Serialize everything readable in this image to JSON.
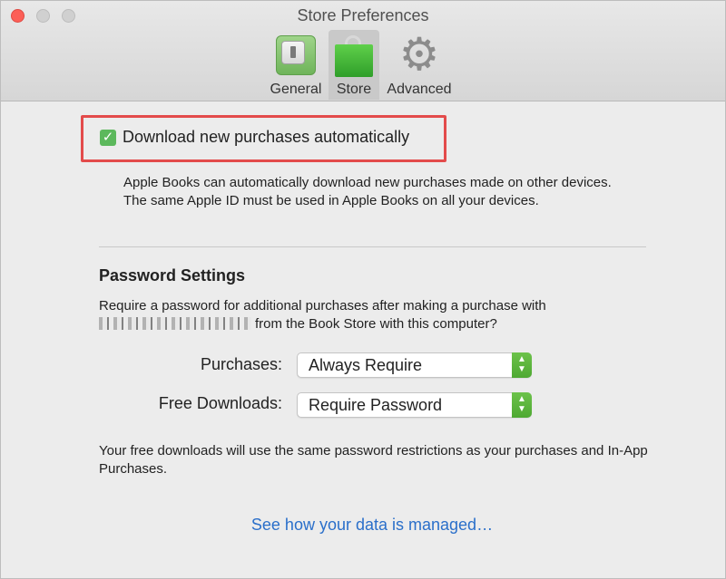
{
  "window": {
    "title": "Store Preferences"
  },
  "toolbar": {
    "tabs": [
      {
        "label": "General",
        "icon": "general-switch-icon"
      },
      {
        "label": "Store",
        "icon": "shopping-bag-icon",
        "selected": true
      },
      {
        "label": "Advanced",
        "icon": "gear-icon"
      }
    ]
  },
  "auto_download": {
    "checked": true,
    "label": "Download new purchases automatically",
    "description": "Apple Books can automatically download new purchases made on other devices. The same Apple ID must be used in Apple Books on all your devices."
  },
  "password_settings": {
    "title": "Password Settings",
    "description_suffix": "from the Book Store with this computer?",
    "description_prefix": "Require a password for additional purchases after making a purchase with",
    "purchases_label": "Purchases:",
    "purchases_value": "Always Require",
    "free_downloads_label": "Free Downloads:",
    "free_downloads_value": "Require Password",
    "footer": "Your free downloads will use the same password restrictions as your purchases and In-App Purchases."
  },
  "link": {
    "text": "See how your data is managed…"
  },
  "colors": {
    "accent_green": "#5cb85c",
    "link_blue": "#2a6fca",
    "highlight_red": "#e34b4b"
  }
}
